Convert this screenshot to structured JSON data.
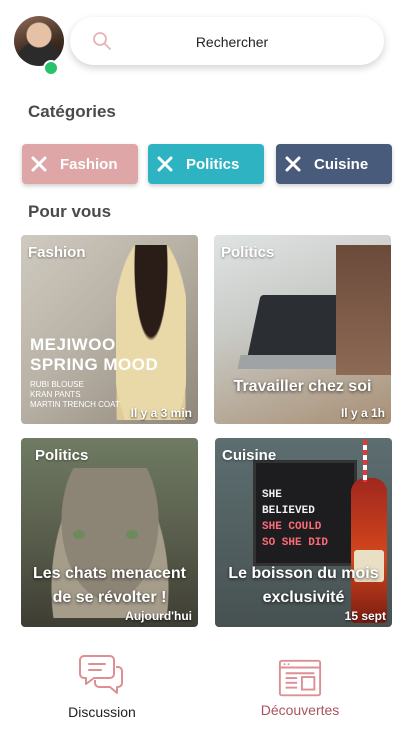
{
  "search": {
    "placeholder": "Rechercher"
  },
  "categories": {
    "title": "Catégories",
    "chips": [
      {
        "label": "Fashion",
        "color": "#dea6a7"
      },
      {
        "label": "Politics",
        "color": "#2db3c2"
      },
      {
        "label": "Cuisine",
        "color": "#495b7b"
      }
    ]
  },
  "feed": {
    "title": "Pour vous",
    "cards": [
      {
        "tag": "Fashion",
        "time": "Il y a 3 min",
        "overlay_lines": [
          "MEJIWOO",
          "SPRING MOOD",
          "RUBI BLOUSE",
          "KRAN PANTS",
          "MARTIN TRENCH COAT"
        ]
      },
      {
        "tag": "Politics",
        "title": "Travailler chez soi",
        "time": "Il y a 1h"
      },
      {
        "tag": "Politics",
        "title": "Les chats menacent de se révolter !",
        "time": "Aujourd'hui"
      },
      {
        "tag": "Cuisine",
        "title": "Le boisson du mois exclusivité",
        "time": "15 sept",
        "sign_lines": [
          "SHE",
          "BELIEVED",
          "SHE COULD",
          "SO SHE DID"
        ]
      }
    ]
  },
  "nav": {
    "discussion": {
      "label": "Discussion"
    },
    "decouvertes": {
      "label": "Découvertes",
      "color": "#a8545c"
    }
  },
  "colors": {
    "accent": "#c97b80",
    "online": "#27c26a"
  }
}
